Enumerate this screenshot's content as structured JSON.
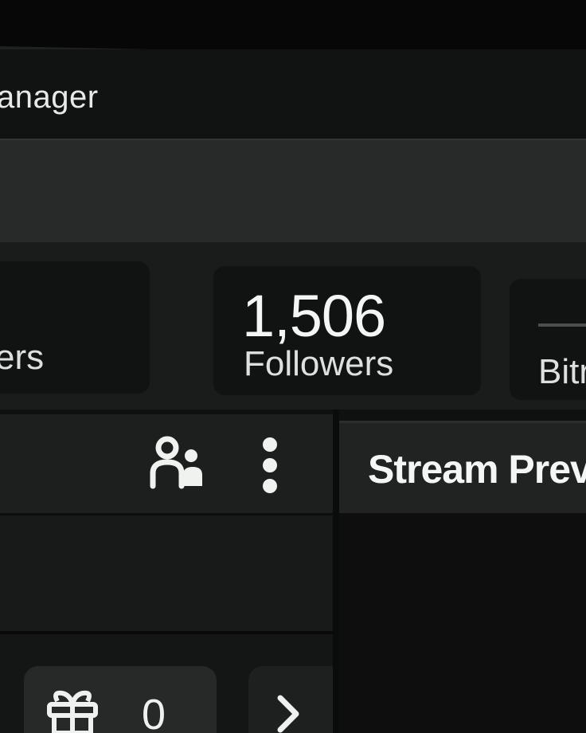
{
  "app": {
    "title": "anager"
  },
  "stats": [
    {
      "value": "",
      "label": "ers"
    },
    {
      "value": "1,506",
      "label": "Followers"
    },
    {
      "value": "",
      "label": "Bitr"
    }
  ],
  "chat_panel": {
    "users_icon": "users-icon",
    "more_icon": "more-vertical-icon",
    "gift_icon": "gift-icon",
    "gift_count": "0",
    "next_icon": "chevron-right-icon"
  },
  "preview": {
    "title": "Stream Prev"
  },
  "colors": {
    "background": "#0f1110",
    "card": "#111312",
    "text": "#e9ecea"
  }
}
